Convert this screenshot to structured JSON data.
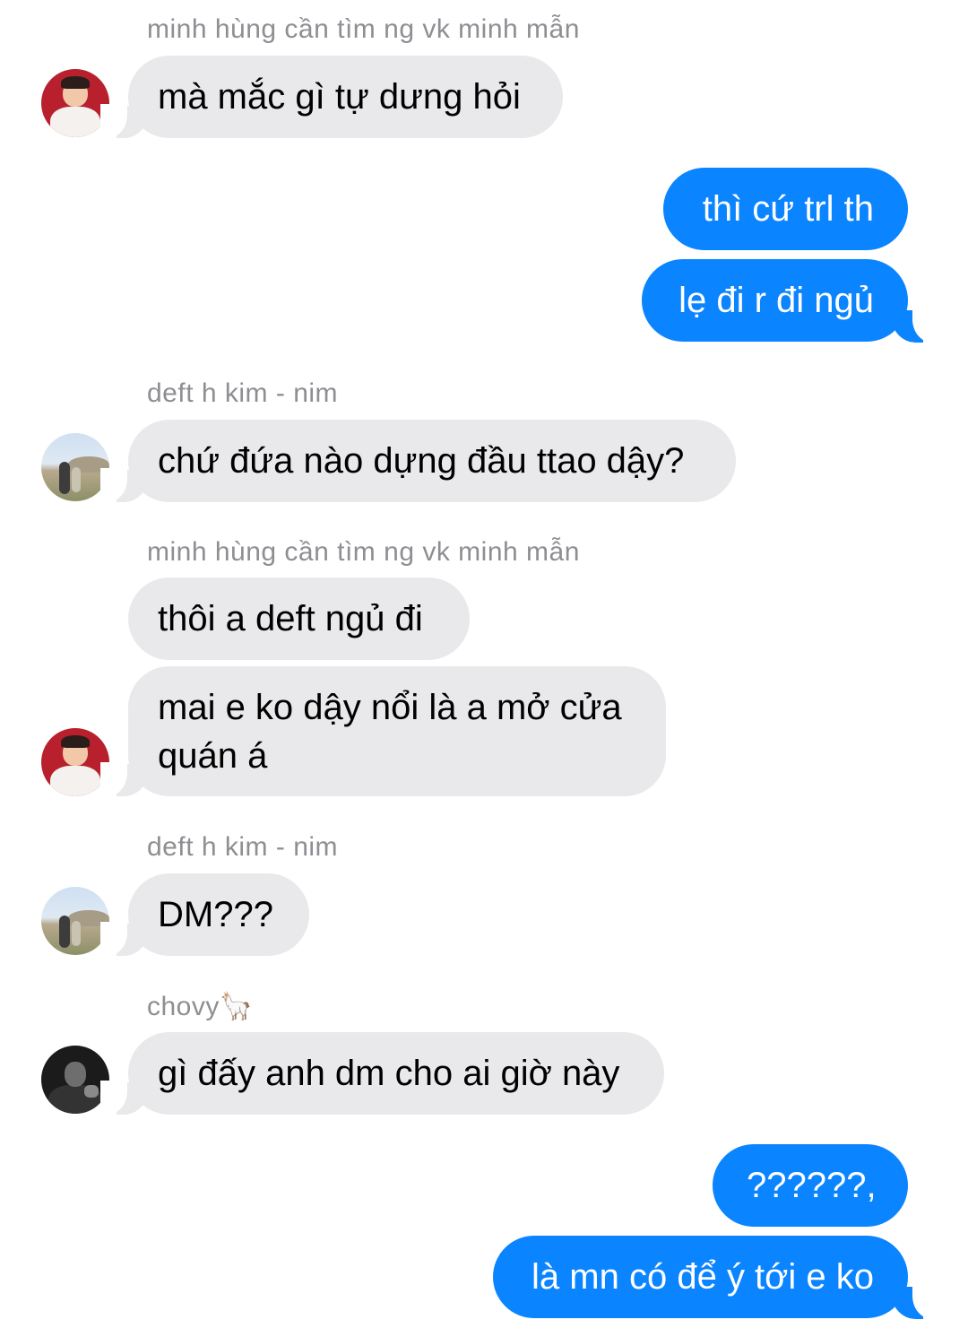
{
  "messages": [
    {
      "sender": "minh hùng cần tìm ng vk minh mẫn",
      "text": "mà mắc gì tự dưng hỏi"
    },
    {
      "text": "thì cứ trl th"
    },
    {
      "text": "lẹ đi r đi ngủ"
    },
    {
      "sender": "deft h kim - nim",
      "text": "chứ đứa nào dựng đầu ttao dậy?"
    },
    {
      "sender": "minh hùng cần tìm ng vk minh mẫn",
      "text": "thôi a deft ngủ đi"
    },
    {
      "text": "mai e ko dậy nổi là a mở cửa",
      "text2": "quán á"
    },
    {
      "sender": "deft h kim - nim",
      "text": "DM???"
    },
    {
      "sender": "chovy",
      "sender_emoji": "🦙",
      "text": "gì đấy anh dm cho ai giờ này"
    },
    {
      "text": "??????,"
    },
    {
      "text": "là mn có để ý tới e ko"
    }
  ],
  "colors": {
    "incoming_bubble": "#e9e9eb",
    "outgoing_bubble": "#0a84ff",
    "sender_name": "#8e8e93"
  }
}
